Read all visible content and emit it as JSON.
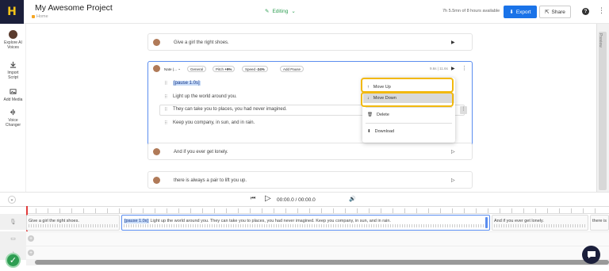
{
  "header": {
    "project_title": "My Awesome Project",
    "breadcrumb": "Home",
    "mode": "Editing",
    "quota": "7h 5.5mn of 8 hours available",
    "export_label": "Export",
    "share_label": "Share"
  },
  "sidebar": {
    "items": [
      {
        "label1": "Explore AI",
        "label2": "Voices"
      },
      {
        "label1": "Import",
        "label2": "Script"
      },
      {
        "label1": "Add Media",
        "label2": ""
      },
      {
        "label1": "Voice",
        "label2": "Changer"
      }
    ]
  },
  "blocks": {
    "first": "Give a girl the right shoes.",
    "voice_name": "Nate (...",
    "style": "General",
    "pitch": "Pitch",
    "pitch_value": "+9%",
    "speed": "Speed",
    "speed_value": "-24%",
    "add_pause": "Add Pause",
    "duration": "9.6s | 11.6s",
    "lines": [
      "[pause 1.0s]",
      "Light up the world around you.",
      "They can take you to places, you had never imagined.",
      "Keep you company, in sun, and in rain."
    ],
    "after1": "And if you ever get lonely.",
    "after2": "there is always a pair to lift you up."
  },
  "context_menu": {
    "move_up": "Move Up",
    "move_down": "Move Down",
    "delete": "Delete",
    "download": "Download"
  },
  "player": {
    "time": "00:00.0 / 00:00.0"
  },
  "timeline": {
    "clip1": "Give a girl the right shoes.",
    "clip2_pause": "[pause 1.0s]",
    "clip2": " Light up the world around you. They can take you to places, you had never imagined. Keep you company, in sun, and in rain.",
    "clip3": "And if you ever get lonely.",
    "clip4": "there is"
  },
  "preview_label": "Preview",
  "colors": {
    "accent": "#1a73e8",
    "highlight": "#f2b90f",
    "success": "#2e9e52",
    "logo_bg": "#1b1f3b"
  }
}
